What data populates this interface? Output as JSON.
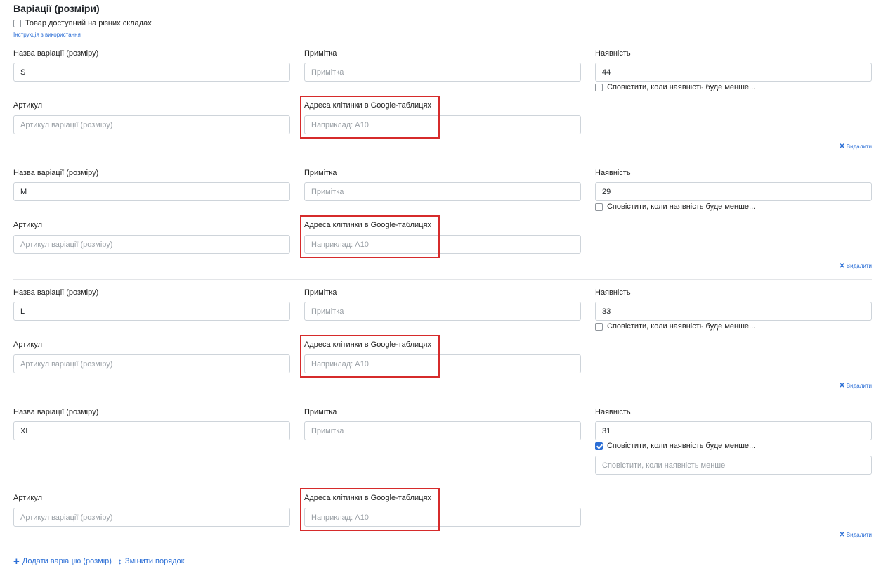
{
  "section": {
    "title": "Варіації (розміри)",
    "multi_warehouse_label": "Товар доступний на різних складах",
    "instructions_link": "Інструкція з використання"
  },
  "labels": {
    "name": "Назва варіації (розміру)",
    "note": "Примітка",
    "stock": "Наявність",
    "sku": "Артикул",
    "gsheet": "Адреса клітинки в Google-таблицях",
    "notify": "Сповістити, коли наявність буде менше...",
    "delete": "Видалити"
  },
  "placeholders": {
    "note": "Примітка",
    "sku": "Артикул варіації (розміру)",
    "gsheet": "Наприклад: A10",
    "notify_threshold": "Сповістити, коли наявність менше"
  },
  "variations": [
    {
      "name": "S",
      "stock": "44",
      "notify_checked": false
    },
    {
      "name": "M",
      "stock": "29",
      "notify_checked": false
    },
    {
      "name": "L",
      "stock": "33",
      "notify_checked": false
    },
    {
      "name": "XL",
      "stock": "31",
      "notify_checked": true
    }
  ],
  "actions": {
    "add_variation": "Додати варіацію (розмір)",
    "reorder": "Змінити порядок"
  },
  "colors": {
    "accent": "#2c6fd6",
    "highlight": "#d62b2b",
    "border": "#ced4da"
  },
  "icons": {
    "delete": "close-icon",
    "add": "plus-icon",
    "reorder": "up-down-arrows-icon"
  }
}
